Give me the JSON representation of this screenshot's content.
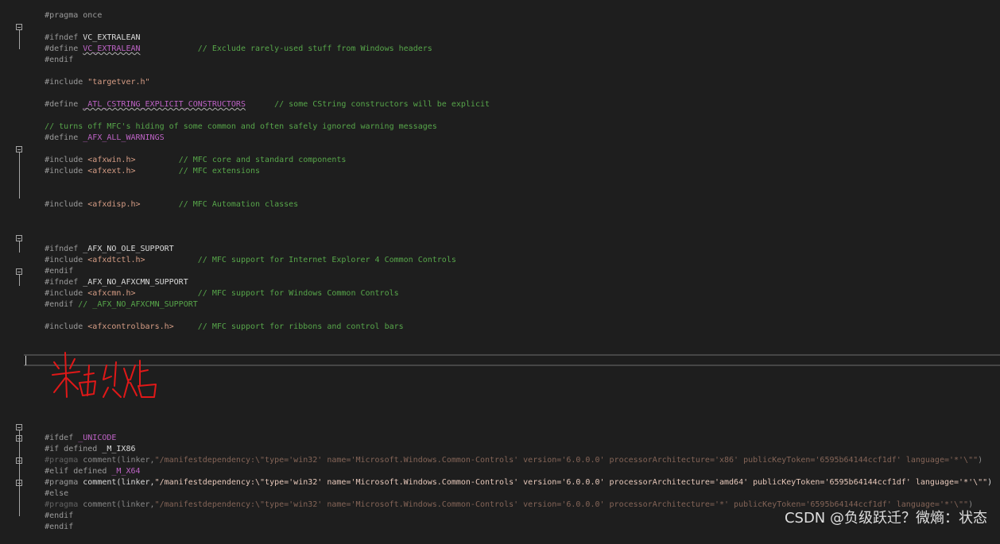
{
  "editor": {
    "lines": [
      {
        "pp": "#pragma once"
      },
      {
        "pp": "#ifndef ",
        "name": "VC_EXTRALEAN"
      },
      {
        "pp": "#define ",
        "macro": "VC_EXTRALEAN",
        "comment": "// Exclude rarely-used stuff from Windows headers"
      },
      {
        "pp": "#endif"
      },
      {
        "pp": "#include ",
        "str": "\"targetver.h\""
      },
      {
        "pp": "#define ",
        "macro": "_ATL_CSTRING_EXPLICIT_CONSTRUCTORS",
        "comment": "// some CString constructors will be explicit"
      },
      {
        "comment": "// turns off MFC's hiding of some common and often safely ignored warning messages"
      },
      {
        "pp": "#define ",
        "macro": "_AFX_ALL_WARNINGS"
      },
      {
        "pp": "#include ",
        "str": "<afxwin.h>",
        "comment": "// MFC core and standard components"
      },
      {
        "pp": "#include ",
        "str": "<afxext.h>",
        "comment": "// MFC extensions"
      },
      {
        "pp": "#include ",
        "str": "<afxdisp.h>",
        "comment": "// MFC Automation classes"
      },
      {
        "pp": "#ifndef ",
        "name": "_AFX_NO_OLE_SUPPORT"
      },
      {
        "pp": "#include ",
        "str": "<afxdtctl.h>",
        "comment": "// MFC support for Internet Explorer 4 Common Controls"
      },
      {
        "pp": "#endif"
      },
      {
        "pp": "#ifndef ",
        "name": "_AFX_NO_AFXCMN_SUPPORT"
      },
      {
        "pp": "#include ",
        "str": "<afxcmn.h>",
        "comment": "// MFC support for Windows Common Controls"
      },
      {
        "pp": "#endif ",
        "comment": "// _AFX_NO_AFXCMN_SUPPORT"
      },
      {
        "pp": "#include ",
        "str": "<afxcontrolbars.h>",
        "comment": "// MFC support for ribbons and control bars"
      },
      {
        "pp": "#ifdef ",
        "macro": "_UNICODE"
      },
      {
        "pp": "#if defined ",
        "name": "_M_IX86"
      },
      {
        "pp": "#pragma ",
        "fn": "comment(linker,",
        "str": "\"/manifestdependency:\\\"type='win32' name='Microsoft.Windows.Common-Controls' version='6.0.0.0' processorArchitecture='x86' publicKeyToken='6595b64144ccf1df' language='*'\\\"\"",
        "tail": ")"
      },
      {
        "pp": "#elif defined ",
        "macro": "_M_X64"
      },
      {
        "pp": "#pragma ",
        "fn": "comment(linker,",
        "str": "\"/manifestdependency:\\\"type='win32' name='Microsoft.Windows.Common-Controls' version='6.0.0.0' processorArchitecture='amd64' publicKeyToken='6595b64144ccf1df' language='*'\\\"\"",
        "tail": ")"
      },
      {
        "pp": "#else"
      },
      {
        "pp": "#pragma ",
        "fn": "comment(linker,",
        "str": "\"/manifestdependency:\\\"type='win32' name='Microsoft.Windows.Common-Controls' version='6.0.0.0' processorArchitecture='*' publicKeyToken='6595b64144ccf1df' language='*'\\\"\"",
        "tail": ")"
      },
      {
        "pp": "#endif"
      },
      {
        "pp": "#endif"
      }
    ],
    "annotation": "粘贴"
  },
  "watermark": "CSDN @负级跃迁？微熵：状态"
}
